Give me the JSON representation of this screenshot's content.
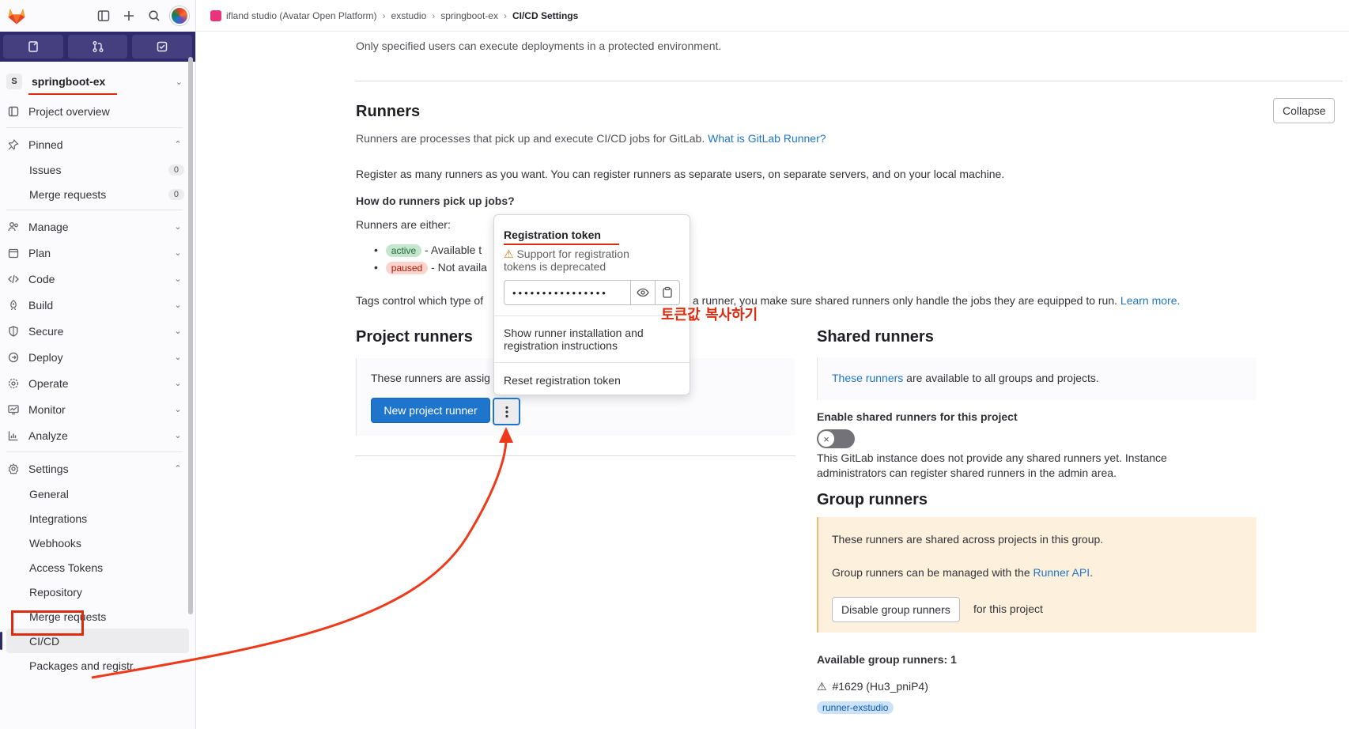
{
  "sidebar": {
    "project_initial": "S",
    "project_name": "springboot-ex",
    "items": {
      "project_overview": "Project overview",
      "pinned": "Pinned",
      "issues": "Issues",
      "issues_count": "0",
      "merge_requests": "Merge requests",
      "merge_requests_count": "0",
      "manage": "Manage",
      "plan": "Plan",
      "code": "Code",
      "build": "Build",
      "secure": "Secure",
      "deploy": "Deploy",
      "operate": "Operate",
      "monitor": "Monitor",
      "analyze": "Analyze",
      "settings": "Settings",
      "general": "General",
      "integrations": "Integrations",
      "webhooks": "Webhooks",
      "access_tokens": "Access Tokens",
      "repository": "Repository",
      "settings_merge_requests": "Merge requests",
      "cicd": "CI/CD",
      "packages": "Packages and registr..."
    }
  },
  "breadcrumb": {
    "group": "ifland studio (Avatar Open Platform)",
    "subgroup": "exstudio",
    "project": "springboot-ex",
    "current": "CI/CD Settings"
  },
  "main": {
    "env_note": "Only specified users can execute deployments in a protected environment.",
    "runners_title": "Runners",
    "collapse": "Collapse",
    "runners_desc": "Runners are processes that pick up and execute CI/CD jobs for GitLab.",
    "runners_link": "What is GitLab Runner?",
    "register_text": "Register as many runners as you want. You can register runners as separate users, on separate servers, and on your local machine.",
    "how_title": "How do runners pick up jobs?",
    "runners_either": "Runners are either:",
    "badge_active": "active",
    "active_text": "- Available t",
    "badge_paused": "paused",
    "paused_text": "- Not availa",
    "tags_text_a": "Tags control which type of",
    "tags_text_b": "a runner, you make sure shared runners only handle the jobs they are equipped to run.",
    "learn_more": "Learn more.",
    "project_runners_title": "Project runners",
    "project_runners_text": "These runners are assig",
    "new_runner": "New project runner",
    "shared_title": "Shared runners",
    "these_runners": "These runners",
    "shared_text": "are available to all groups and projects.",
    "enable_shared": "Enable shared runners for this project",
    "no_shared": "This GitLab instance does not provide any shared runners yet. Instance administrators can register shared runners in the admin area.",
    "group_title": "Group runners",
    "group_shared": "These runners are shared across projects in this group.",
    "group_managed": "Group runners can be managed with the",
    "runner_api": "Runner API",
    "disable_group": "Disable group runners",
    "for_project": "for this project",
    "available_group": "Available group runners: 1",
    "runner_id": "#1629 (Hu3_pniP4)",
    "runner_tag": "runner-exstudio"
  },
  "dropdown": {
    "title": "Registration token",
    "warning": "Support for registration tokens is deprecated",
    "token_mask": "••••••••••••••••",
    "show_instructions": "Show runner installation and registration instructions",
    "reset_token": "Reset registration token"
  },
  "annotation": {
    "copy_token": "토큰값 복사하기"
  },
  "colors": {
    "accent": "#1f75cb",
    "annotation_red": "#dd2b0e",
    "nav_dark": "#2f2a6b"
  }
}
